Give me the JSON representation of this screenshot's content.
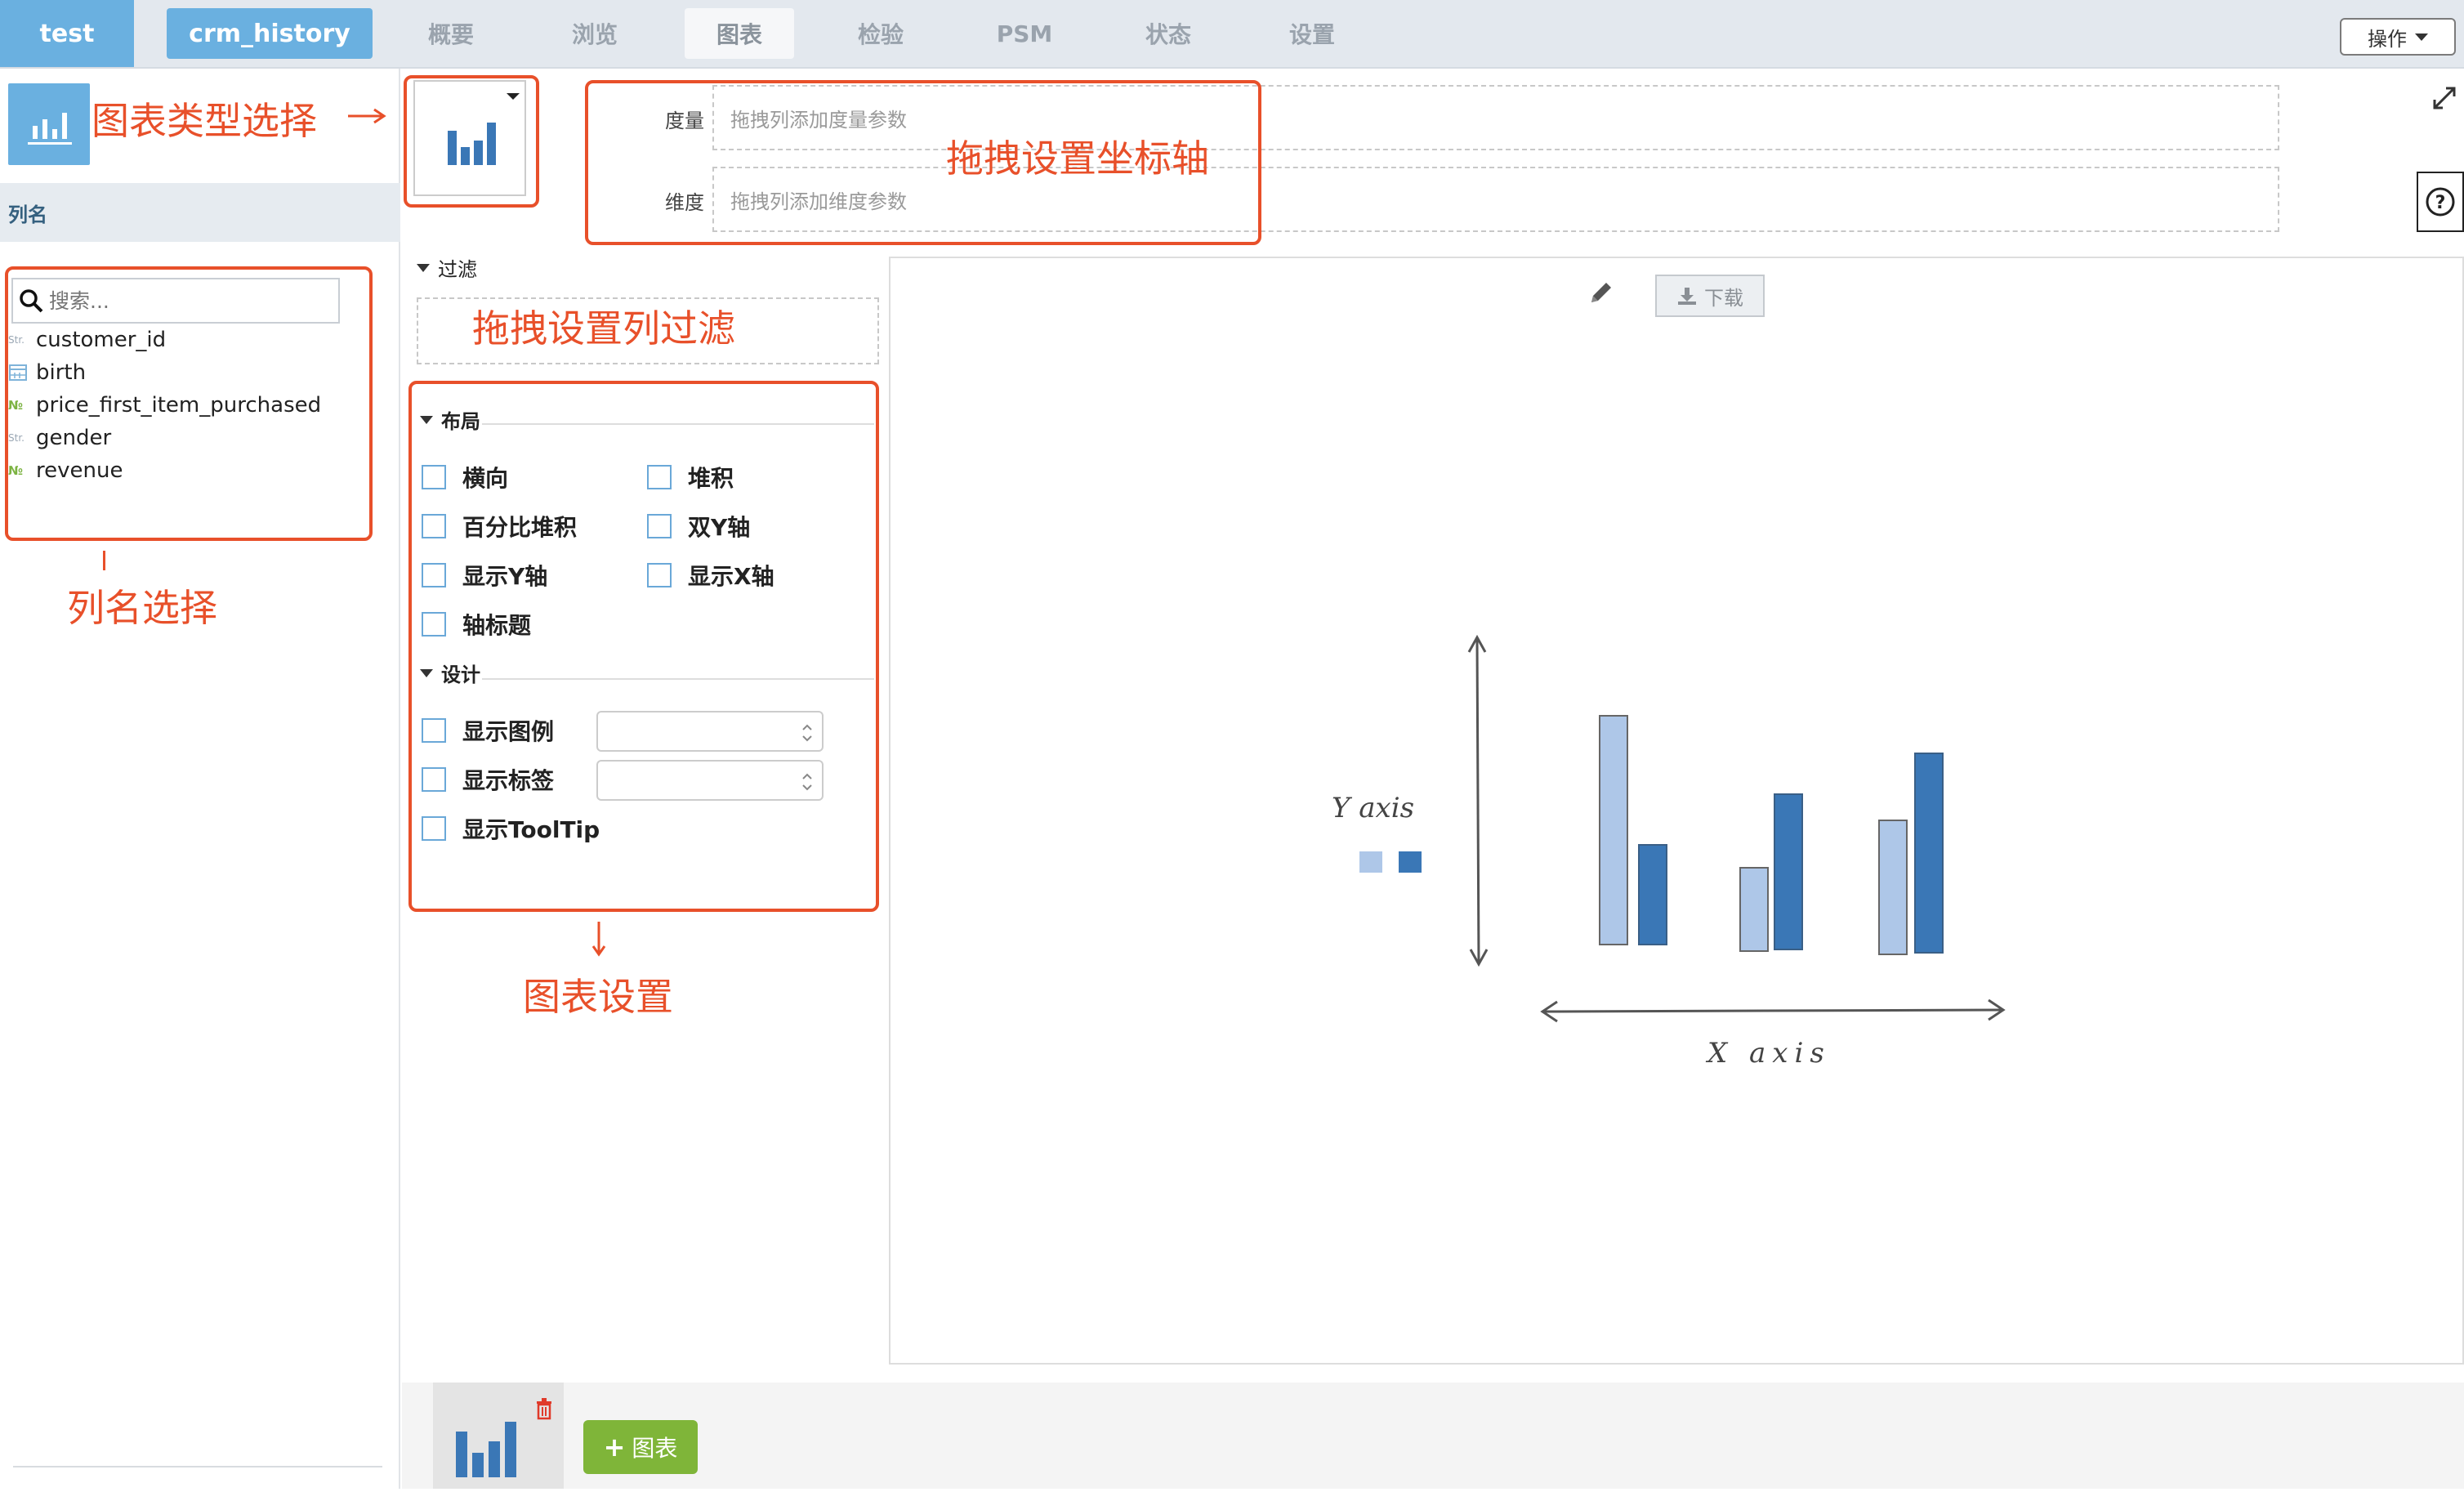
{
  "nav": {
    "project": "test",
    "dataset": "crm_history",
    "tabs": [
      "概要",
      "浏览",
      "图表",
      "检验",
      "PSM",
      "状态",
      "设置"
    ],
    "active_tab": "图表",
    "action_button": "操作"
  },
  "sidebar": {
    "column_header": "列名",
    "search_placeholder": "搜索...",
    "columns": [
      {
        "name": "customer_id",
        "type": "Str"
      },
      {
        "name": "birth",
        "type": "date"
      },
      {
        "name": "price_first_item_purchased",
        "type": "No"
      },
      {
        "name": "gender",
        "type": "Str"
      },
      {
        "name": "revenue",
        "type": "No"
      }
    ]
  },
  "axes": {
    "measure_label": "度量",
    "measure_placeholder": "拖拽列添加度量参数",
    "dimension_label": "维度",
    "dimension_placeholder": "拖拽列添加维度参数"
  },
  "filter": {
    "title": "过滤"
  },
  "layout": {
    "title": "布局",
    "options": [
      "横向",
      "堆积",
      "百分比堆积",
      "双Y轴",
      "显示Y轴",
      "显示X轴",
      "轴标题"
    ]
  },
  "design": {
    "title": "设计",
    "options": [
      "显示图例",
      "显示标签",
      "显示ToolTip"
    ]
  },
  "chart": {
    "download_label": "下载",
    "placeholder_ylabel": "Y axis",
    "placeholder_xlabel": "X axis"
  },
  "bottom": {
    "add_chart_label": "图表"
  },
  "annotations": {
    "chart_type": "图表类型选择",
    "axis_setup": "拖拽设置坐标轴",
    "column_filter": "拖拽设置列过滤",
    "column_select": "列名选择",
    "chart_settings": "图表设置"
  },
  "colors": {
    "accent_blue": "#6ab0e0",
    "annotation_red": "#e8502a",
    "bar_light": "#aec7e8",
    "bar_dark": "#3a77b6",
    "add_green": "#7fb539"
  }
}
